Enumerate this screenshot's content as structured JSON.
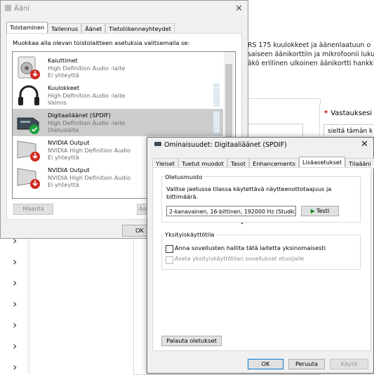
{
  "background": {
    "text_lines": [
      "RS 175 kuulokkeet ja äänenlaatuun o",
      "saiseen äänikorttiin ja mikrofoonii lukuun",
      "äkö erillinen ulkoinen äänikortti hankkia"
    ],
    "answer_label": "Vastauksesi",
    "answer_field_text": "sieltä tämän k"
  },
  "sound_dialog": {
    "title": "Ääni",
    "tabs": [
      "Toistaminen",
      "Tallennus",
      "Äänet",
      "Tietoliikenneyhteydet"
    ],
    "instruction": "Muokkaa alla olevan toistolaitteen asetuksia valitsemalla se:",
    "devices": [
      {
        "name": "Kaiuttimet",
        "driver": "High Definition Audio -laite",
        "status": "Ei yhteyttä"
      },
      {
        "name": "Kuulokkeet",
        "driver": "High Definition Audio -laite",
        "status": "Valmis"
      },
      {
        "name": "Digitaaliäänet (SPDIF)",
        "driver": "High Definition Audio -laite",
        "status": "Oletuslaite"
      },
      {
        "name": "NVIDIA Output",
        "driver": "NVIDIA High Definition Audio",
        "status": "Ei yhteyttä"
      },
      {
        "name": "NVIDIA Output",
        "driver": "NVIDIA High Definition Audio",
        "status": "Ei yhteyttä"
      }
    ],
    "configure_button": "Määritä",
    "set_default_button": "Ase",
    "ok_button": "OK"
  },
  "properties_dialog": {
    "title": "Ominaisuudet: Digitaaliäänet (SPDIF)",
    "tabs": [
      "Yleiset",
      "Tuetut muodot",
      "Tasot",
      "Enhancements",
      "Lisäasetukset",
      "Tilaääni"
    ],
    "active_tab": "Lisäasetukset",
    "default_format": {
      "label": "Oletusmuoto",
      "description": "Valitse jaetussa tilassa käytettävä näytteenottotaajuus ja bittimäärä.",
      "selected_format": "2-kanavainen, 16-bittinen, 192000 Hz (Studic",
      "test_button": "Testi"
    },
    "exclusive_mode": {
      "label": "Yksityiskäyttötila",
      "option1": "Anna sovellusten hallita tätä laitetta yksinomaisesti",
      "option1_checked": false,
      "option2": "Aseta yksityiskäyttötilan sovellukset etusijalle",
      "option2_checked": false
    },
    "restore_defaults_button": "Palauta oletukset",
    "ok_button": "OK",
    "cancel_button": "Peruuta",
    "apply_button": "Käytä"
  },
  "colors": {
    "accent": "#0078d7",
    "default_badge": "#1e9e3a",
    "disconnected_badge": "#d02b20"
  }
}
